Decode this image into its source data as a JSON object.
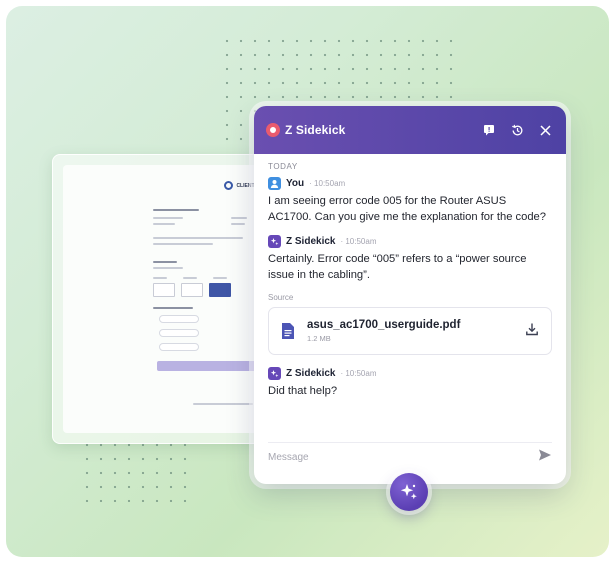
{
  "chat": {
    "title": "Z Sidekick",
    "day_label": "TODAY",
    "messages": [
      {
        "sender": "You",
        "time": "10:50am",
        "text": "I am seeing error code 005 for the Router ASUS AC1700. Can you give me the explanation for the code?"
      },
      {
        "sender": "Z Sidekick",
        "time": "10:50am",
        "text": "Certainly. Error code “005” refers to a “power source issue in the cabling”."
      },
      {
        "sender": "Z Sidekick",
        "time": "10:50am",
        "text": "Did that help?"
      }
    ],
    "source": {
      "label": "Source",
      "file_name": "asus_ac1700_userguide.pdf",
      "file_size": "1.2 MB"
    },
    "composer": {
      "placeholder": "Message"
    },
    "icons": {
      "header": [
        "feedback-icon",
        "history-icon",
        "close-icon"
      ],
      "file": "document-icon",
      "download": "download-icon",
      "send": "send-icon",
      "launcher": "sparkle-icon"
    }
  },
  "background_form": {
    "brand": "CLIENT LO..."
  },
  "colors": {
    "header_start": "#6a4fb0",
    "header_end": "#4e42a4",
    "accent": "#5b3fb3",
    "user_avatar": "#3f8fe0"
  }
}
